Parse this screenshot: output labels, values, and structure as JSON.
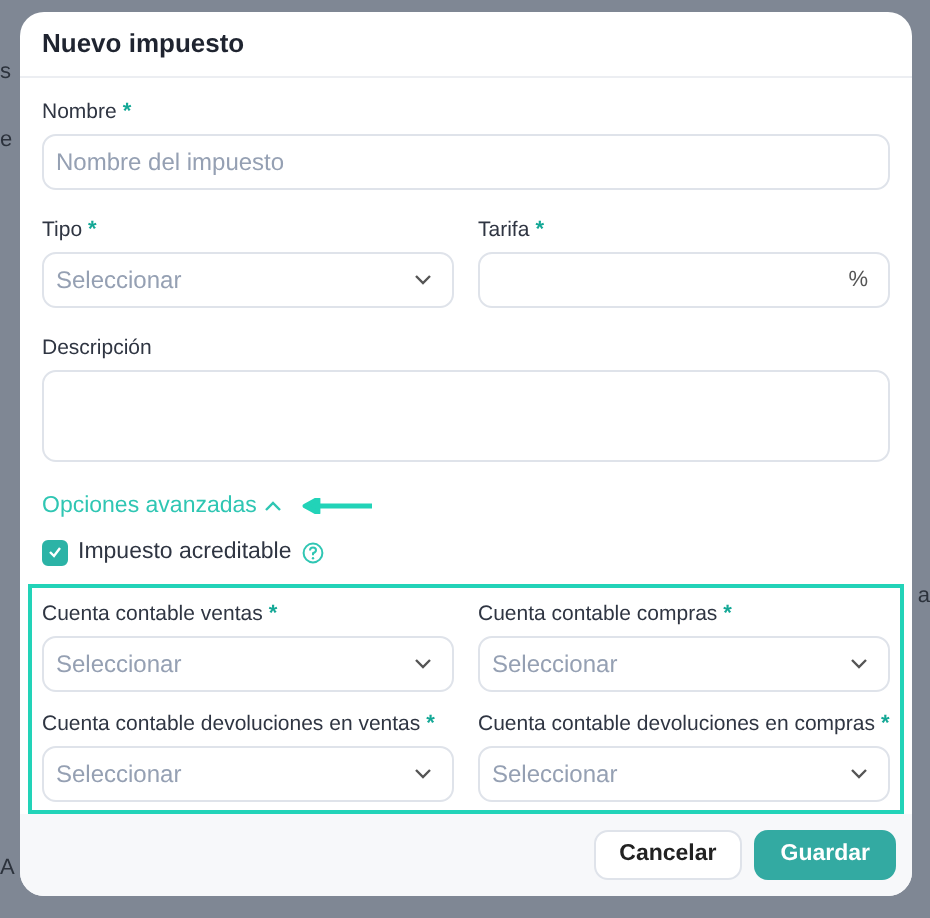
{
  "background_fragments": [
    "s",
    "e",
    "a",
    "A"
  ],
  "dialog": {
    "title": "Nuevo impuesto",
    "name_field": {
      "label": "Nombre",
      "required_mark": "*",
      "placeholder": "Nombre del impuesto"
    },
    "type_field": {
      "label": "Tipo",
      "required_mark": "*",
      "placeholder": "Seleccionar"
    },
    "rate_field": {
      "label": "Tarifa",
      "required_mark": "*",
      "suffix": "%"
    },
    "description_field": {
      "label": "Descripción"
    },
    "advanced_toggle": {
      "label": "Opciones avanzadas",
      "expanded": true
    },
    "creditable_checkbox": {
      "label": "Impuesto acreditable",
      "checked": true
    },
    "account_fields": [
      {
        "label": "Cuenta contable ventas",
        "required_mark": "*",
        "placeholder": "Seleccionar"
      },
      {
        "label": "Cuenta contable compras",
        "required_mark": "*",
        "placeholder": "Seleccionar"
      },
      {
        "label": "Cuenta contable devoluciones en ventas",
        "required_mark": "*",
        "placeholder": "Seleccionar"
      },
      {
        "label": "Cuenta contable devoluciones en compras",
        "required_mark": "*",
        "placeholder": "Seleccionar"
      }
    ],
    "buttons": [
      {
        "label": "Cancelar",
        "kind": "secondary"
      },
      {
        "label": "Guardar",
        "kind": "primary"
      }
    ]
  }
}
